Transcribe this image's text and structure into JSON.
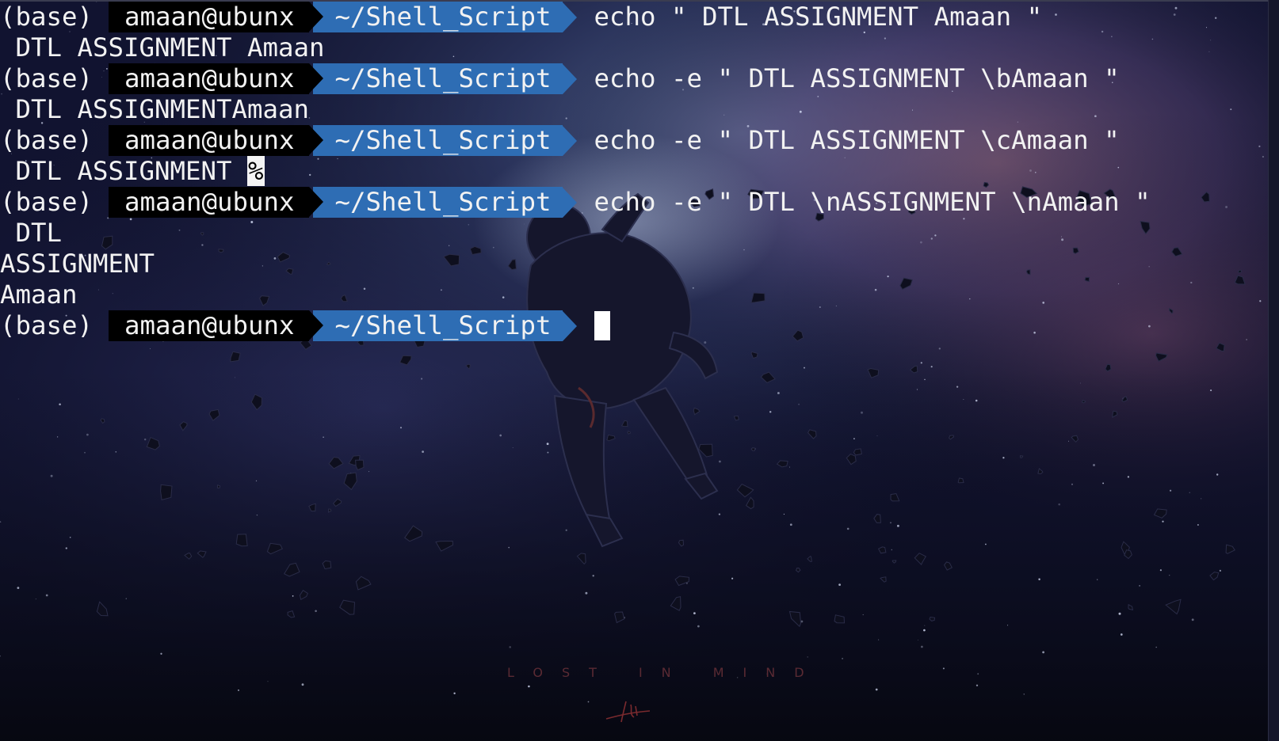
{
  "colors": {
    "terminal_text": "#f2f2f2",
    "user_segment_bg": "#000000",
    "dir_segment_bg": "#2e6db4",
    "cursor": "#ffffff"
  },
  "prompt": {
    "conda_env": "(base)",
    "user_host": "amaan@ubunx",
    "cwd": "~/Shell_Script"
  },
  "lines": [
    {
      "type": "prompt",
      "command": "echo \" DTL ASSIGNMENT Amaan \""
    },
    {
      "type": "output",
      "text": " DTL ASSIGNMENT Amaan"
    },
    {
      "type": "prompt",
      "command": "echo -e \" DTL ASSIGNMENT \\bAmaan \""
    },
    {
      "type": "output",
      "text": " DTL ASSIGNMENTAmaan"
    },
    {
      "type": "prompt",
      "command": "echo -e \" DTL ASSIGNMENT \\cAmaan \""
    },
    {
      "type": "output",
      "text": " DTL ASSIGNMENT ",
      "marker": "%"
    },
    {
      "type": "prompt",
      "command": "echo -e \" DTL \\nASSIGNMENT \\nAmaan \""
    },
    {
      "type": "output",
      "text": " DTL"
    },
    {
      "type": "output",
      "text": "ASSIGNMENT"
    },
    {
      "type": "output",
      "text": "Amaan"
    },
    {
      "type": "prompt",
      "command": "",
      "cursor": true
    }
  ],
  "wallpaper": {
    "caption": "LOST IN MIND"
  }
}
